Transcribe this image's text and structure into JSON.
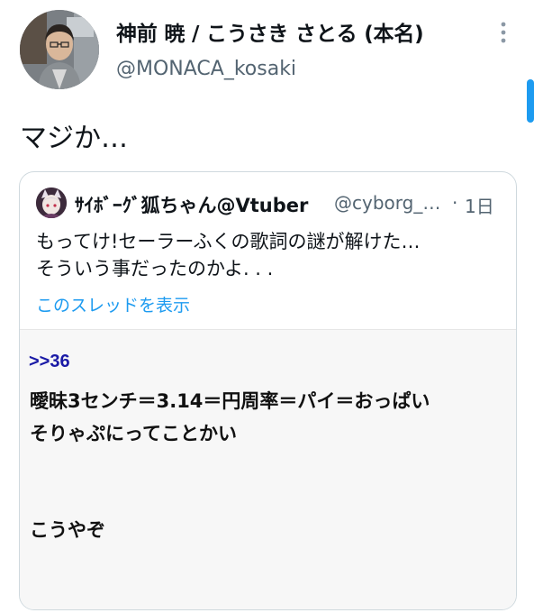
{
  "tweet": {
    "author_name": "神前 暁 / こうさき さとる (本名)",
    "author_handle": "@MONACA_kosaki",
    "text": "マジか…"
  },
  "quote": {
    "author_name": "ｻｲﾎﾞｰｸﾞ狐ちゃん@Vtuber",
    "author_handle": "@cyborg_…",
    "separator": "·",
    "time": "1日",
    "text_lines": [
      "もってけ!セーラーふくの歌詞の謎が解けた…",
      "そういう事だったのかよ. . ."
    ],
    "thread_link": "このスレッドを表示",
    "image": {
      "ref": ">>36",
      "lines": [
        "曖昧3センチ＝3.14＝円周率＝パイ＝おっぱい",
        "そりゃぷにってことかい",
        "こうやぞ"
      ]
    }
  },
  "icons": {
    "more": "more-vertical-icon"
  },
  "colors": {
    "link": "#1d9bf0",
    "secondary_text": "#536471",
    "image_ref": "#1a1aa6"
  }
}
